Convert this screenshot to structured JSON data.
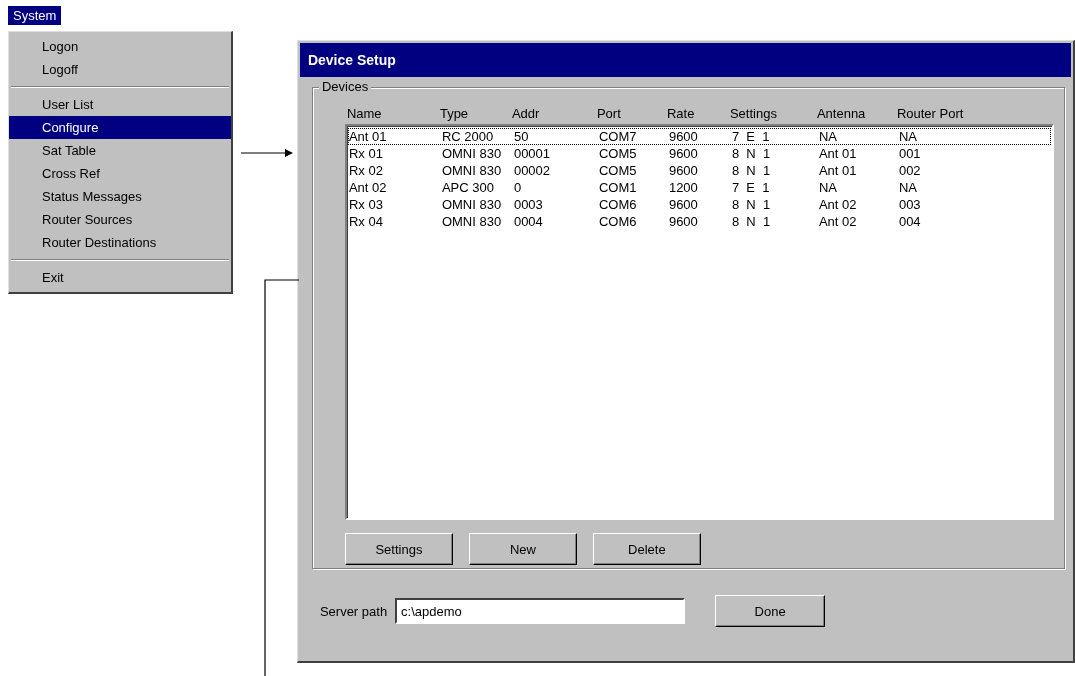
{
  "menu": {
    "title": "System",
    "items": [
      {
        "kind": "item",
        "label": "Logon",
        "selected": false
      },
      {
        "kind": "item",
        "label": "Logoff",
        "selected": false
      },
      {
        "kind": "separator"
      },
      {
        "kind": "item",
        "label": "User List",
        "selected": false
      },
      {
        "kind": "item",
        "label": "Configure",
        "selected": true
      },
      {
        "kind": "item",
        "label": "Sat Table",
        "selected": false
      },
      {
        "kind": "item",
        "label": "Cross Ref",
        "selected": false
      },
      {
        "kind": "item",
        "label": "Status Messages",
        "selected": false
      },
      {
        "kind": "item",
        "label": "Router Sources",
        "selected": false
      },
      {
        "kind": "item",
        "label": "Router Destinations",
        "selected": false
      },
      {
        "kind": "separator"
      },
      {
        "kind": "item",
        "label": "Exit",
        "selected": false
      }
    ]
  },
  "window": {
    "title": "Device Setup"
  },
  "devices": {
    "label": "Devices",
    "columns": [
      "Name",
      "Type",
      "Addr",
      "Port",
      "Rate",
      "Settings",
      "Antenna",
      "Router Port"
    ],
    "rows": [
      {
        "selected": true,
        "cells": [
          "Ant 01",
          "RC 2000",
          "50",
          "COM7",
          "9600",
          "7  E  1",
          "NA",
          "NA"
        ]
      },
      {
        "selected": false,
        "cells": [
          "Rx 01",
          "OMNI 830",
          "00001",
          "COM5",
          "9600",
          "8  N  1",
          "Ant 01",
          "001"
        ]
      },
      {
        "selected": false,
        "cells": [
          "Rx 02",
          "OMNI 830",
          "00002",
          "COM5",
          "9600",
          "8  N  1",
          "Ant 01",
          "002"
        ]
      },
      {
        "selected": false,
        "cells": [
          "Ant 02",
          "APC 300",
          "0",
          "COM1",
          "1200",
          "7  E  1",
          "NA",
          "NA"
        ]
      },
      {
        "selected": false,
        "cells": [
          "Rx 03",
          "OMNI 830",
          "0003",
          "COM6",
          "9600",
          "8  N  1",
          "Ant 02",
          "003"
        ]
      },
      {
        "selected": false,
        "cells": [
          "Rx 04",
          "OMNI 830",
          "0004",
          "COM6",
          "9600",
          "8  N  1",
          "Ant 02",
          "004"
        ]
      }
    ],
    "buttons": [
      "Settings",
      "New",
      "Delete"
    ]
  },
  "server_path": {
    "label": "Server path",
    "value": "c:\\apdemo"
  },
  "done_button": "Done"
}
